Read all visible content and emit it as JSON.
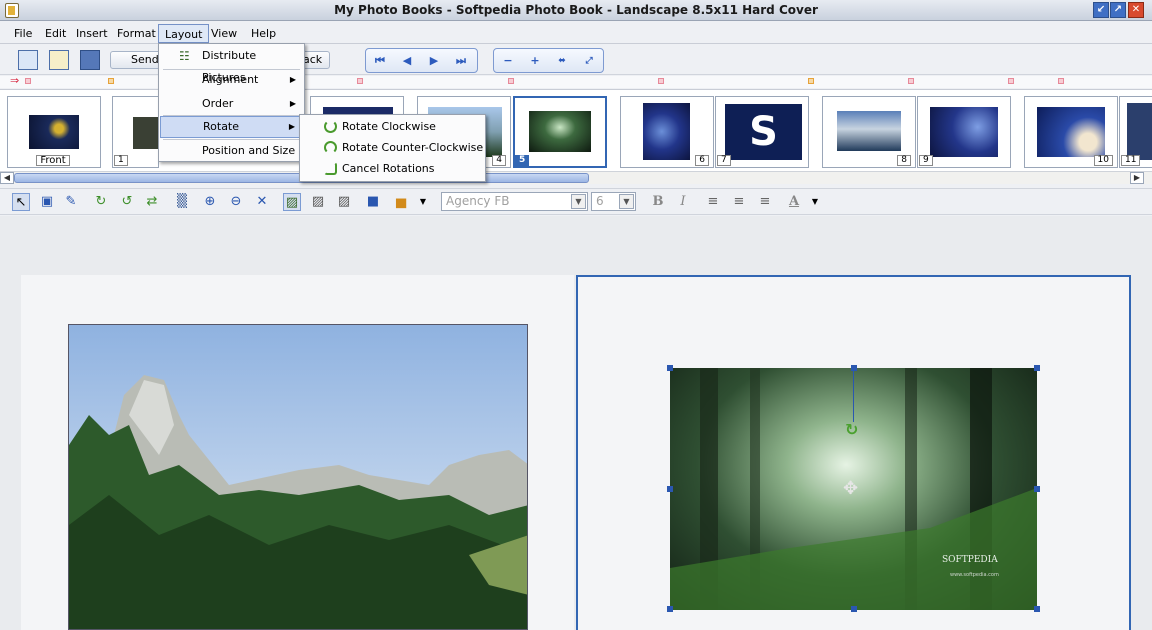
{
  "window": {
    "title": "My Photo Books - Softpedia Photo Book - Landscape 8.5x11 Hard Cover",
    "minimize_glyph": "↙",
    "maximize_glyph": "↗",
    "close_glyph": "✕"
  },
  "menubar": {
    "items": [
      "File",
      "Edit",
      "Insert",
      "Format",
      "Layout",
      "View",
      "Help"
    ],
    "active": "Layout"
  },
  "toolbar": {
    "send_label": "Send",
    "back_label": "ack"
  },
  "layout_menu": {
    "items": [
      {
        "label": "Distribute Pictures",
        "submenu": false
      },
      {
        "label": "Alignment",
        "submenu": true
      },
      {
        "label": "Order",
        "submenu": true
      },
      {
        "label": "Rotate",
        "submenu": true,
        "highlighted": true
      },
      {
        "label": "Position and Size",
        "submenu": false
      }
    ]
  },
  "rotate_submenu": {
    "items": [
      "Rotate Clockwise",
      "Rotate Counter-Clockwise",
      "Cancel Rotations"
    ]
  },
  "thumbnails": {
    "labels": [
      "Front",
      "1",
      "",
      "",
      "4",
      "5",
      "6",
      "7",
      "8",
      "9",
      "10",
      "11"
    ],
    "selected": "5"
  },
  "format_toolbar": {
    "font_family": "Agency FB",
    "font_size": "6",
    "bold": "B",
    "italic": "I",
    "text_color_glyph": "A"
  },
  "navigation": {
    "first": "⏮",
    "prev": "◀",
    "next": "▶",
    "last": "⏭",
    "zoom_out": "−",
    "zoom_in": "+"
  },
  "photos": {
    "right_watermark": "SOFTPEDIA",
    "right_url": "www.softpedia.com"
  },
  "colors": {
    "accent": "#3266b3",
    "menu_highlight": "#cfdcf4"
  }
}
